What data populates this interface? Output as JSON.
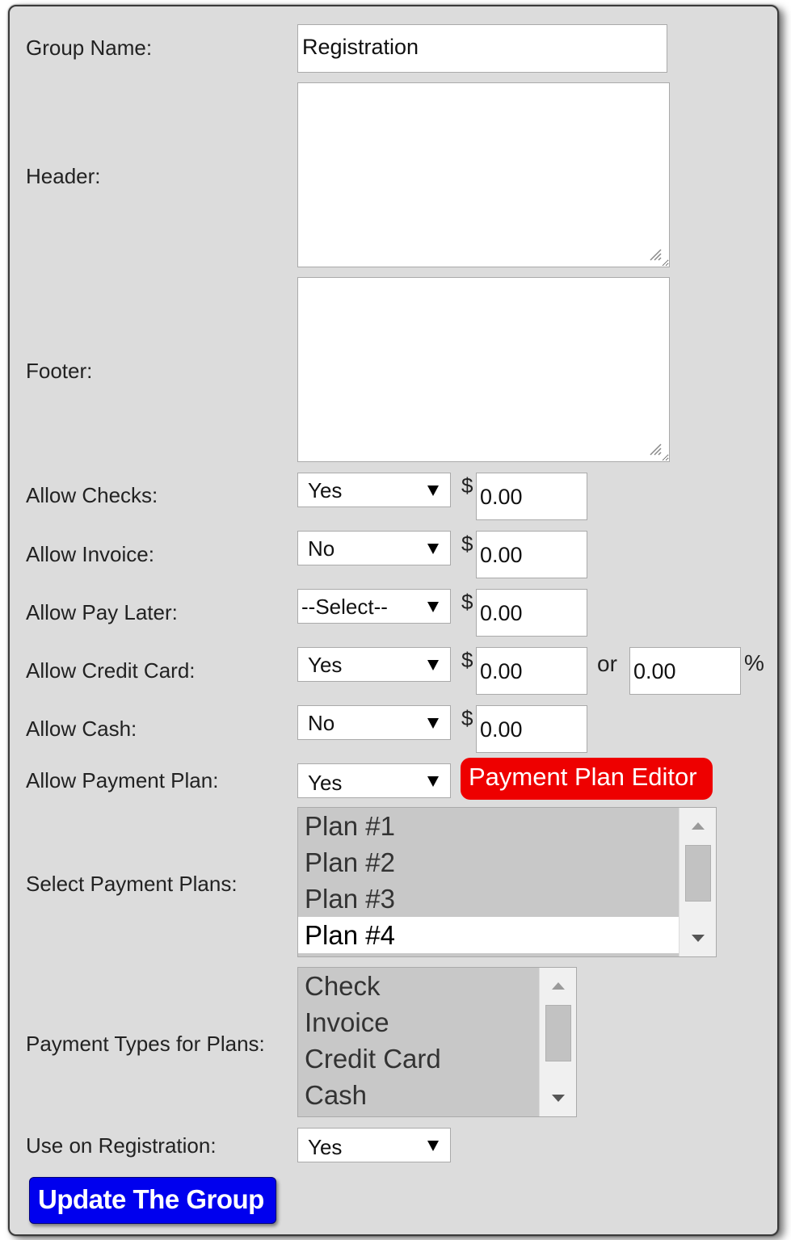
{
  "form": {
    "group_name_label": "Group Name:",
    "group_name_value": "Registration",
    "header_label": "Header:",
    "header_value": "",
    "footer_label": "Footer:",
    "footer_value": "",
    "currency_symbol": "$",
    "percent_symbol": "%",
    "or_label": "or",
    "rows": {
      "checks": {
        "label": "Allow Checks:",
        "selected": "Yes",
        "amount": "0.00"
      },
      "invoice": {
        "label": "Allow Invoice:",
        "selected": "No",
        "amount": "0.00"
      },
      "pay_later": {
        "label": "Allow Pay Later:",
        "selected": "--Select--",
        "amount": "0.00"
      },
      "credit_card": {
        "label": "Allow Credit Card:",
        "selected": "Yes",
        "amount": "0.00",
        "percent": "0.00"
      },
      "cash": {
        "label": "Allow Cash:",
        "selected": "No",
        "amount": "0.00"
      },
      "payment_plan": {
        "label": "Allow Payment Plan:",
        "selected": "Yes",
        "editor_button": "Payment Plan Editor"
      }
    },
    "select_plans_label": "Select Payment Plans:",
    "plans": [
      "Plan #1",
      "Plan #2",
      "Plan #3",
      "Plan #4"
    ],
    "plans_highlighted_index": 3,
    "payment_types_label": "Payment Types for Plans:",
    "payment_types": [
      "Check",
      "Invoice",
      "Credit Card",
      "Cash"
    ],
    "use_on_registration_label": "Use on Registration:",
    "use_on_registration_selected": "Yes",
    "update_button": "Update The Group"
  },
  "colors": {
    "panel_bg": "#dcdcdc",
    "editor_button_bg": "#ee0000",
    "update_button_bg": "#0000ee",
    "listbox_bg": "#c8c8c8"
  },
  "icons": [
    "dropdown-arrow-icon",
    "scroll-up-icon",
    "scroll-down-icon",
    "resize-grip-icon"
  ]
}
